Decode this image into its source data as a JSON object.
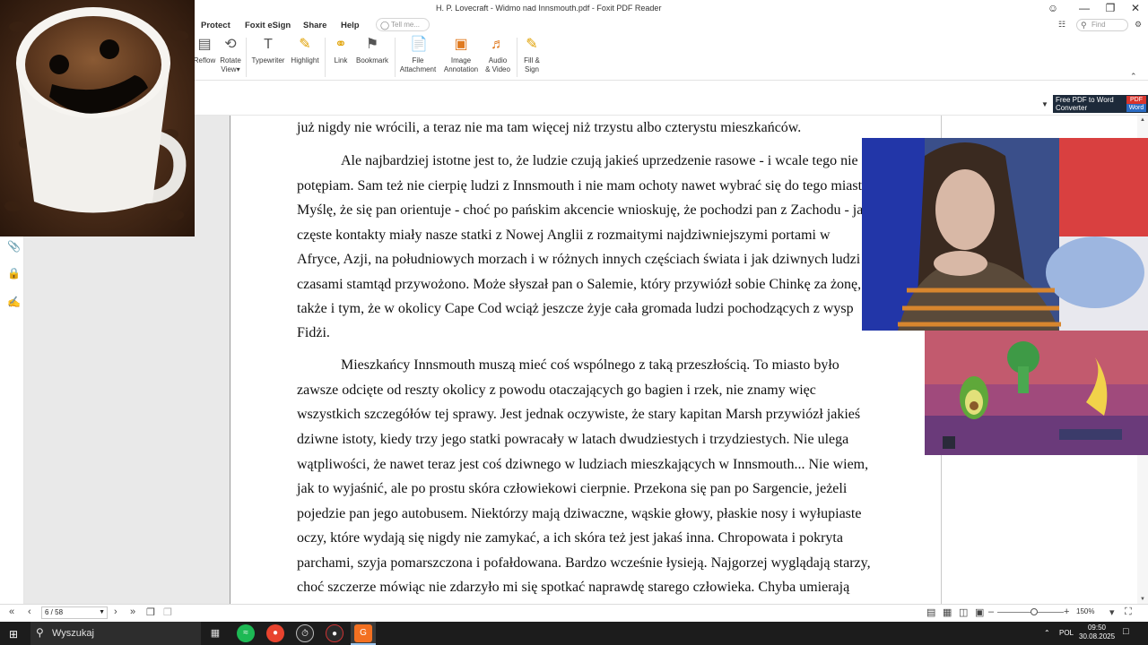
{
  "window": {
    "title": "H. P. Lovecraft - Widmo nad Innsmouth.pdf - Foxit PDF Reader"
  },
  "menu": {
    "tabs": [
      "Protect",
      "Foxit eSign",
      "Share",
      "Help"
    ],
    "tell_me_placeholder": "Tell me...",
    "find_placeholder": "Find"
  },
  "ribbon": {
    "buttons": [
      {
        "label": "Reflow",
        "icon": "reflow-icon"
      },
      {
        "label": "Rotate",
        "label2": "View",
        "icon": "rotate-view-icon"
      },
      {
        "label": "Typewriter",
        "icon": "typewriter-icon"
      },
      {
        "label": "Highlight",
        "icon": "highlight-icon"
      },
      {
        "label": "Link",
        "icon": "link-icon"
      },
      {
        "label": "Bookmark",
        "icon": "bookmark-icon"
      },
      {
        "label": "File",
        "label2": "Attachment",
        "icon": "file-attachment-icon"
      },
      {
        "label": "Image",
        "label2": "Annotation",
        "icon": "image-annotation-icon"
      },
      {
        "label": "Audio",
        "label2": "& Video",
        "icon": "audio-video-icon"
      },
      {
        "label": "Fill &",
        "label2": "Sign",
        "icon": "fill-sign-icon"
      }
    ]
  },
  "promo": {
    "text1": "Free PDF to Word",
    "text2": "Converter",
    "badge1": "PDF",
    "badge2": "Word"
  },
  "document": {
    "lines": [
      "już nigdy nie wrócili, a teraz nie ma tam więcej niż trzystu albo czterystu mieszkańców.",
      "Ale najbardziej istotne jest to, że ludzie czują jakieś uprzedzenie rasowe - i wcale tego nie",
      "potępiam. Sam też nie cierpię ludzi z Innsmouth i nie mam ochoty nawet wybrać się do tego miasta.",
      "Myślę, że się pan orientuje - choć po pańskim akcencie wnioskuję, że pochodzi pan z Zachodu - jak",
      "częste kontakty miały nasze statki z Nowej Anglii z rozmaitymi najdziwniejszymi portami w",
      "Afryce, Azji, na południowych morzach i w różnych innych częściach świata i jak dziwnych ludzi",
      "czasami stamtąd przywożono. Może słyszał pan o Salemie, który przywiózł sobie Chinkę za żonę,",
      "także i tym, że w okolicy Cape Cod wciąż jeszcze żyje cała gromada ludzi pochodzących z wysp",
      "Fidżi.",
      "Mieszkańcy Innsmouth muszą mieć coś wspólnego z taką przeszłością. To miasto było",
      "zawsze odcięte od reszty okolicy z powodu otaczających go bagien i rzek, nie znamy więc",
      "wszystkich szczegółów tej sprawy. Jest jednak oczywiste, że stary kapitan Marsh przywiózł jakieś",
      "dziwne istoty, kiedy trzy jego statki powracały w latach dwudziestych i trzydziestych. Nie ulega",
      "wątpliwości, że nawet teraz jest coś dziwnego w ludziach mieszkających w Innsmouth... Nie wiem,",
      "jak to wyjaśnić, ale po prostu skóra człowiekowi cierpnie. Przekona się pan po Sargencie, jeżeli",
      "pojedzie pan jego autobusem. Niektórzy mają dziwaczne, wąskie głowy, płaskie nosy i wyłupiaste",
      "oczy, które wydają się nigdy nie zamykać, a ich skóra też jest jakaś inna. Chropowata i pokryta",
      "parchami, szyja pomarszczona i pofałdowana. Bardzo wcześnie łysieją. Najgorzej wyglądają starzy,",
      "choć szczerze mówiąc nie zdarzyło mi się spotkać naprawdę starego człowieka. Chyba umierają"
    ]
  },
  "statusbar": {
    "page_indicator": "6 / 58",
    "zoom": "150%",
    "zoom_fraction": 0.55
  },
  "taskbar": {
    "search_placeholder": "Wyszukaj",
    "language": "POL",
    "time": "09:50",
    "date": "30.08.2025"
  },
  "colors": {
    "accent": "#f37021",
    "foxit_orange": "#f37021",
    "taskbar": "#1c1c1c"
  }
}
